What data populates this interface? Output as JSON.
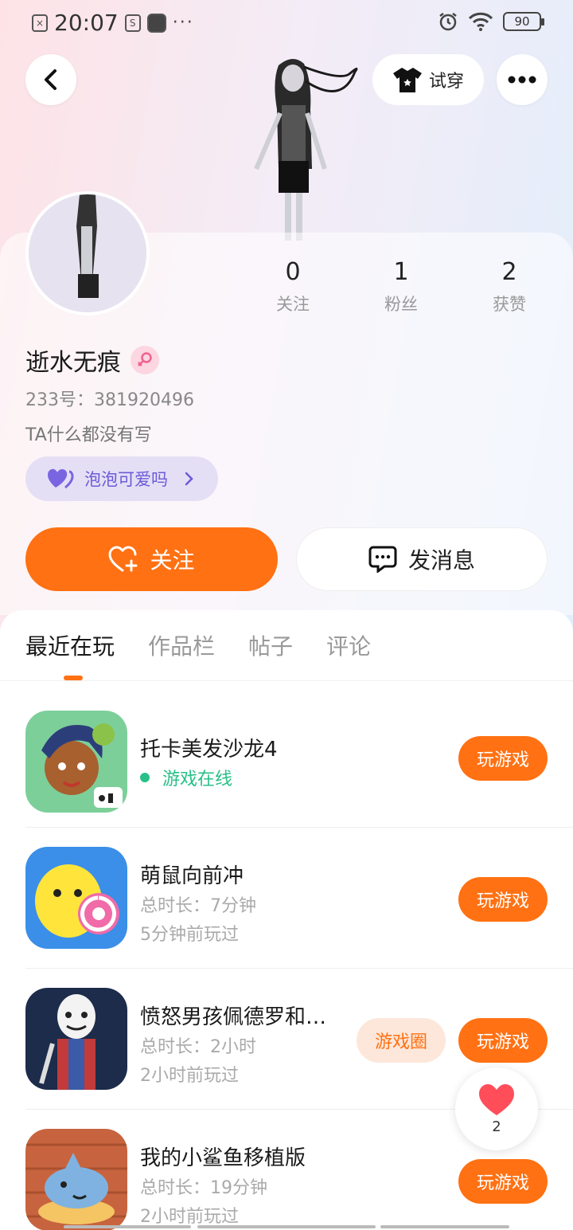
{
  "status_bar": {
    "time": "20:07",
    "dots": "···",
    "battery": "90"
  },
  "header": {
    "tryon_label": "试穿"
  },
  "profile": {
    "stats": [
      {
        "value": "0",
        "label": "关注"
      },
      {
        "value": "1",
        "label": "粉丝"
      },
      {
        "value": "2",
        "label": "获赞"
      }
    ],
    "username": "逝水无痕",
    "gender": "female",
    "uid": "233号：381920496",
    "bio": "TA什么都没有写",
    "tag_label": "泡泡可爱吗"
  },
  "actions": {
    "follow_label": "关注",
    "message_label": "发消息"
  },
  "tabs": [
    {
      "label": "最近在玩",
      "active": true
    },
    {
      "label": "作品栏",
      "active": false
    },
    {
      "label": "帖子",
      "active": false
    },
    {
      "label": "评论",
      "active": false
    }
  ],
  "games": [
    {
      "name": "托卡美发沙龙4",
      "status": "游戏在线",
      "play_label": "玩游戏"
    },
    {
      "name": "萌鼠向前冲",
      "duration": "总时长：7分钟",
      "last_played": "5分钟前玩过",
      "play_label": "玩游戏"
    },
    {
      "name": "愤怒男孩佩德罗和…",
      "duration": "总时长：2小时",
      "last_played": "2小时前玩过",
      "circle_label": "游戏圈",
      "play_label": "玩游戏"
    },
    {
      "name": "我的小鲨鱼移植版",
      "duration": "总时长：19分钟",
      "last_played": "2小时前玩过",
      "play_label": "玩游戏"
    }
  ],
  "like_float": {
    "count": "2"
  },
  "colors": {
    "accent": "#ff7113",
    "online": "#28c088",
    "tag_purple": "#6b5bd6"
  }
}
